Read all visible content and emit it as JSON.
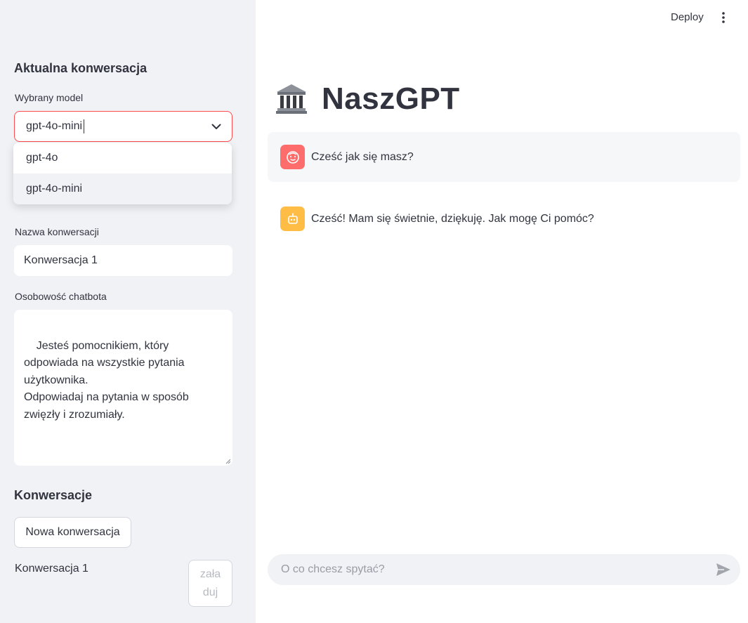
{
  "sidebar": {
    "current_heading": "Aktualna konwersacja",
    "model_label": "Wybrany model",
    "model_selected": "gpt-4o-mini",
    "model_options": [
      "gpt-4o",
      "gpt-4o-mini"
    ],
    "name_label": "Nazwa konwersacji",
    "name_value": "Konwersacja 1",
    "personality_label": "Osobowość chatbota",
    "personality_value": "Jesteś pomocnikiem, który odpowiada na wszystkie pytania użytkownika.\nOdpowiadaj na pytania w sposób zwięzły i zrozumiały.",
    "conversations_heading": "Konwersacje",
    "new_button": "Nowa konwersacja",
    "conversations": [
      {
        "name": "Konwersacja 1",
        "load_label_line1": "zała",
        "load_label_line2": "duj"
      }
    ]
  },
  "header": {
    "deploy_label": "Deploy",
    "menu_icon": "vertical-dots-icon"
  },
  "main": {
    "title": "NaszGPT",
    "title_icon": "classical-building-icon",
    "messages": [
      {
        "role": "user",
        "icon": "user-face-icon",
        "text": "Cześć jak się masz?"
      },
      {
        "role": "assistant",
        "icon": "robot-icon",
        "text": "Cześć! Mam się świetnie, dziękuję. Jak mogę Ci pomóc?"
      }
    ],
    "input_placeholder": "O co chcesz spytać?"
  },
  "colors": {
    "sidebar_bg": "#f0f2f6",
    "accent": "#ff4b4b",
    "user_avatar": "#ff6c6c",
    "bot_avatar": "#ffbd45"
  }
}
